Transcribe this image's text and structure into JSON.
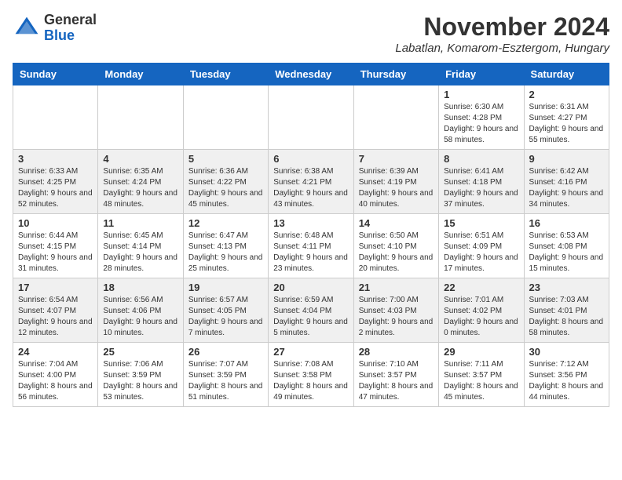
{
  "header": {
    "logo_line1": "General",
    "logo_line2": "Blue",
    "month_year": "November 2024",
    "location": "Labatlan, Komarom-Esztergom, Hungary"
  },
  "weekdays": [
    "Sunday",
    "Monday",
    "Tuesday",
    "Wednesday",
    "Thursday",
    "Friday",
    "Saturday"
  ],
  "weeks": [
    [
      {
        "day": "",
        "sunrise": "",
        "sunset": "",
        "daylight": ""
      },
      {
        "day": "",
        "sunrise": "",
        "sunset": "",
        "daylight": ""
      },
      {
        "day": "",
        "sunrise": "",
        "sunset": "",
        "daylight": ""
      },
      {
        "day": "",
        "sunrise": "",
        "sunset": "",
        "daylight": ""
      },
      {
        "day": "",
        "sunrise": "",
        "sunset": "",
        "daylight": ""
      },
      {
        "day": "1",
        "sunrise": "Sunrise: 6:30 AM",
        "sunset": "Sunset: 4:28 PM",
        "daylight": "Daylight: 9 hours and 58 minutes."
      },
      {
        "day": "2",
        "sunrise": "Sunrise: 6:31 AM",
        "sunset": "Sunset: 4:27 PM",
        "daylight": "Daylight: 9 hours and 55 minutes."
      }
    ],
    [
      {
        "day": "3",
        "sunrise": "Sunrise: 6:33 AM",
        "sunset": "Sunset: 4:25 PM",
        "daylight": "Daylight: 9 hours and 52 minutes."
      },
      {
        "day": "4",
        "sunrise": "Sunrise: 6:35 AM",
        "sunset": "Sunset: 4:24 PM",
        "daylight": "Daylight: 9 hours and 48 minutes."
      },
      {
        "day": "5",
        "sunrise": "Sunrise: 6:36 AM",
        "sunset": "Sunset: 4:22 PM",
        "daylight": "Daylight: 9 hours and 45 minutes."
      },
      {
        "day": "6",
        "sunrise": "Sunrise: 6:38 AM",
        "sunset": "Sunset: 4:21 PM",
        "daylight": "Daylight: 9 hours and 43 minutes."
      },
      {
        "day": "7",
        "sunrise": "Sunrise: 6:39 AM",
        "sunset": "Sunset: 4:19 PM",
        "daylight": "Daylight: 9 hours and 40 minutes."
      },
      {
        "day": "8",
        "sunrise": "Sunrise: 6:41 AM",
        "sunset": "Sunset: 4:18 PM",
        "daylight": "Daylight: 9 hours and 37 minutes."
      },
      {
        "day": "9",
        "sunrise": "Sunrise: 6:42 AM",
        "sunset": "Sunset: 4:16 PM",
        "daylight": "Daylight: 9 hours and 34 minutes."
      }
    ],
    [
      {
        "day": "10",
        "sunrise": "Sunrise: 6:44 AM",
        "sunset": "Sunset: 4:15 PM",
        "daylight": "Daylight: 9 hours and 31 minutes."
      },
      {
        "day": "11",
        "sunrise": "Sunrise: 6:45 AM",
        "sunset": "Sunset: 4:14 PM",
        "daylight": "Daylight: 9 hours and 28 minutes."
      },
      {
        "day": "12",
        "sunrise": "Sunrise: 6:47 AM",
        "sunset": "Sunset: 4:13 PM",
        "daylight": "Daylight: 9 hours and 25 minutes."
      },
      {
        "day": "13",
        "sunrise": "Sunrise: 6:48 AM",
        "sunset": "Sunset: 4:11 PM",
        "daylight": "Daylight: 9 hours and 23 minutes."
      },
      {
        "day": "14",
        "sunrise": "Sunrise: 6:50 AM",
        "sunset": "Sunset: 4:10 PM",
        "daylight": "Daylight: 9 hours and 20 minutes."
      },
      {
        "day": "15",
        "sunrise": "Sunrise: 6:51 AM",
        "sunset": "Sunset: 4:09 PM",
        "daylight": "Daylight: 9 hours and 17 minutes."
      },
      {
        "day": "16",
        "sunrise": "Sunrise: 6:53 AM",
        "sunset": "Sunset: 4:08 PM",
        "daylight": "Daylight: 9 hours and 15 minutes."
      }
    ],
    [
      {
        "day": "17",
        "sunrise": "Sunrise: 6:54 AM",
        "sunset": "Sunset: 4:07 PM",
        "daylight": "Daylight: 9 hours and 12 minutes."
      },
      {
        "day": "18",
        "sunrise": "Sunrise: 6:56 AM",
        "sunset": "Sunset: 4:06 PM",
        "daylight": "Daylight: 9 hours and 10 minutes."
      },
      {
        "day": "19",
        "sunrise": "Sunrise: 6:57 AM",
        "sunset": "Sunset: 4:05 PM",
        "daylight": "Daylight: 9 hours and 7 minutes."
      },
      {
        "day": "20",
        "sunrise": "Sunrise: 6:59 AM",
        "sunset": "Sunset: 4:04 PM",
        "daylight": "Daylight: 9 hours and 5 minutes."
      },
      {
        "day": "21",
        "sunrise": "Sunrise: 7:00 AM",
        "sunset": "Sunset: 4:03 PM",
        "daylight": "Daylight: 9 hours and 2 minutes."
      },
      {
        "day": "22",
        "sunrise": "Sunrise: 7:01 AM",
        "sunset": "Sunset: 4:02 PM",
        "daylight": "Daylight: 9 hours and 0 minutes."
      },
      {
        "day": "23",
        "sunrise": "Sunrise: 7:03 AM",
        "sunset": "Sunset: 4:01 PM",
        "daylight": "Daylight: 8 hours and 58 minutes."
      }
    ],
    [
      {
        "day": "24",
        "sunrise": "Sunrise: 7:04 AM",
        "sunset": "Sunset: 4:00 PM",
        "daylight": "Daylight: 8 hours and 56 minutes."
      },
      {
        "day": "25",
        "sunrise": "Sunrise: 7:06 AM",
        "sunset": "Sunset: 3:59 PM",
        "daylight": "Daylight: 8 hours and 53 minutes."
      },
      {
        "day": "26",
        "sunrise": "Sunrise: 7:07 AM",
        "sunset": "Sunset: 3:59 PM",
        "daylight": "Daylight: 8 hours and 51 minutes."
      },
      {
        "day": "27",
        "sunrise": "Sunrise: 7:08 AM",
        "sunset": "Sunset: 3:58 PM",
        "daylight": "Daylight: 8 hours and 49 minutes."
      },
      {
        "day": "28",
        "sunrise": "Sunrise: 7:10 AM",
        "sunset": "Sunset: 3:57 PM",
        "daylight": "Daylight: 8 hours and 47 minutes."
      },
      {
        "day": "29",
        "sunrise": "Sunrise: 7:11 AM",
        "sunset": "Sunset: 3:57 PM",
        "daylight": "Daylight: 8 hours and 45 minutes."
      },
      {
        "day": "30",
        "sunrise": "Sunrise: 7:12 AM",
        "sunset": "Sunset: 3:56 PM",
        "daylight": "Daylight: 8 hours and 44 minutes."
      }
    ]
  ]
}
